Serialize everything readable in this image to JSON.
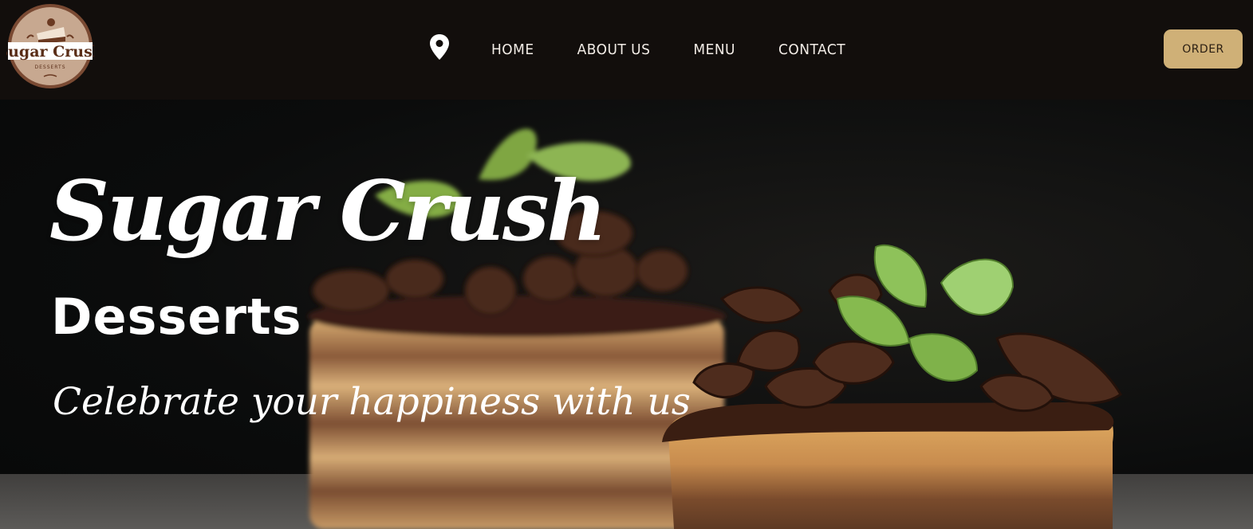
{
  "logo": {
    "name": "Sugar Crush",
    "tagline": "DESSERTS"
  },
  "nav": {
    "location_icon": "location-pin-icon",
    "items": [
      {
        "label": "HOME"
      },
      {
        "label": "ABOUT US"
      },
      {
        "label": "MENU"
      },
      {
        "label": "CONTACT"
      }
    ]
  },
  "header": {
    "order_label": "ORDER"
  },
  "hero": {
    "title": "Sugar Crush",
    "subtitle": "Desserts",
    "tagline": "Celebrate your happiness with us"
  },
  "colors": {
    "header_bg": "#120e0c",
    "accent": "#cfb077",
    "logo_brown": "#6b3a22"
  }
}
